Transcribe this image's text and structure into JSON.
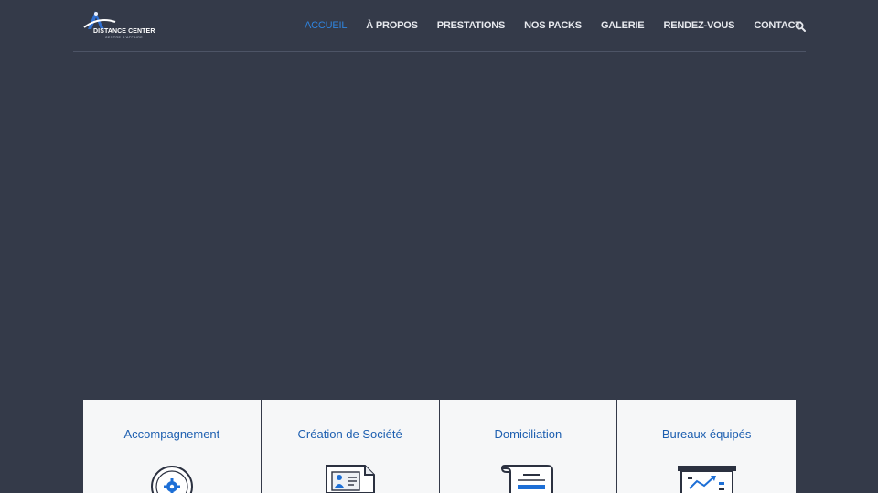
{
  "brand": {
    "name": "DISTANCE CENTER",
    "tagline": "CENTRE D'AFFAIRE"
  },
  "nav": {
    "items": [
      {
        "label": "ACCUEIL",
        "active": true
      },
      {
        "label": "À PROPOS",
        "active": false
      },
      {
        "label": "PRESTATIONS",
        "active": false
      },
      {
        "label": "NOS PACKS",
        "active": false
      },
      {
        "label": "GALERIE",
        "active": false
      },
      {
        "label": "RENDEZ-VOUS",
        "active": false
      },
      {
        "label": "CONTACT",
        "active": false
      }
    ],
    "search_icon": "search-icon"
  },
  "services": [
    {
      "title": "Accompagnement",
      "icon": "gear-icon"
    },
    {
      "title": "Création de Société",
      "icon": "id-card-document-icon"
    },
    {
      "title": "Domiciliation",
      "icon": "scroll-document-icon"
    },
    {
      "title": "Bureaux équipés",
      "icon": "presentation-board-icon"
    }
  ],
  "colors": {
    "background": "#343a49",
    "accent": "#2f84df",
    "card_title": "#1d5fb0",
    "card_bg": "#f6f7f8"
  }
}
